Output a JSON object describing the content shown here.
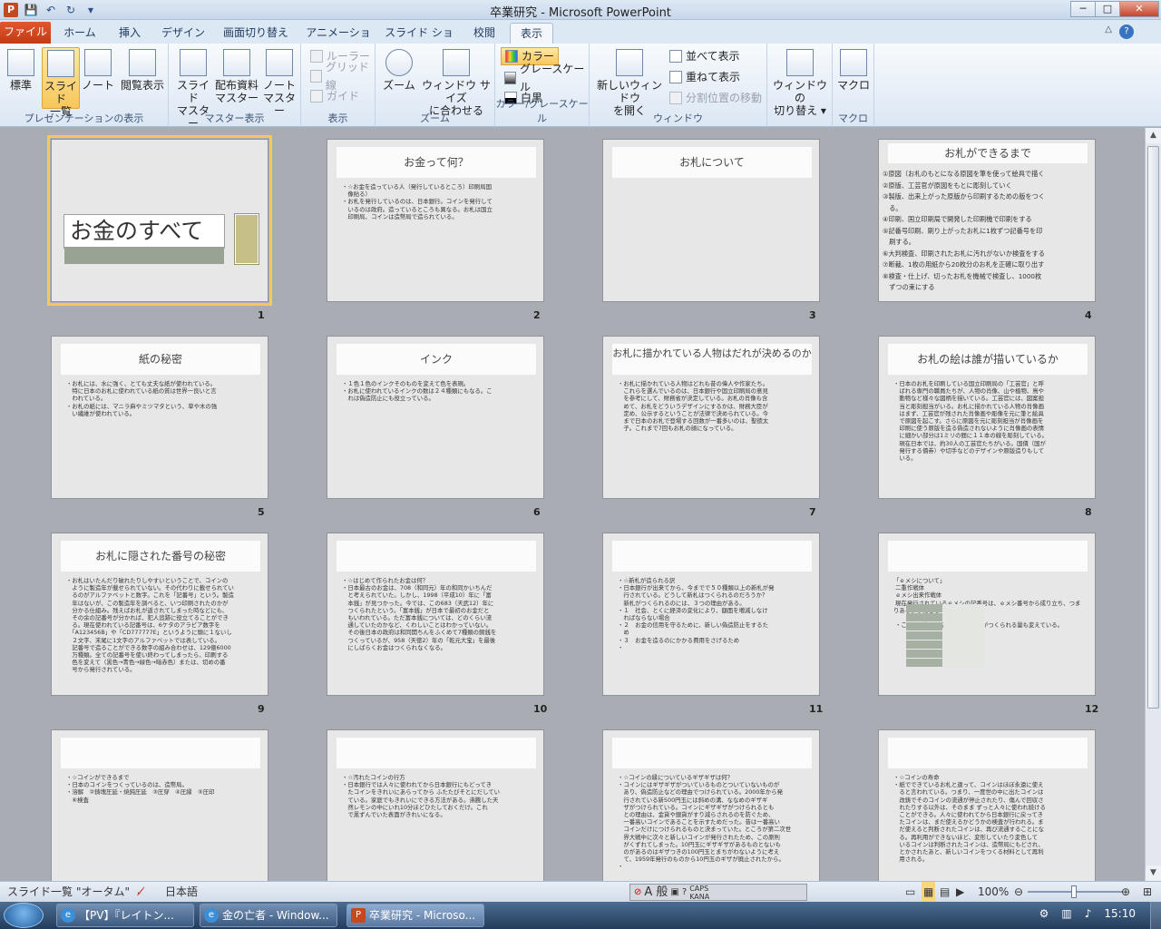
{
  "window": {
    "title": "卒業研究 - Microsoft PowerPoint",
    "app_icon": "P",
    "minimize": "─",
    "maximize": "□",
    "close": "✕"
  },
  "qat": {
    "save": "💾",
    "undo": "↶",
    "redo": "↻",
    "customize": "▾"
  },
  "tabs": [
    {
      "label": "ファイル"
    },
    {
      "label": "ホーム"
    },
    {
      "label": "挿入"
    },
    {
      "label": "デザイン"
    },
    {
      "label": "画面切り替え"
    },
    {
      "label": "アニメーション"
    },
    {
      "label": "スライド ショー"
    },
    {
      "label": "校閲"
    },
    {
      "label": "表示"
    }
  ],
  "ribbon": {
    "groups": {
      "presentation_views": "プレゼンテーションの表示",
      "master_views": "マスター表示",
      "show": "表示",
      "zoom": "ズーム",
      "color": "カラー/グレースケール",
      "window": "ウィンドウ",
      "macros": "マクロ"
    },
    "buttons": {
      "normal": "標準",
      "sorter_1": "スライド",
      "sorter_2": "一覧",
      "notes": "ノート",
      "reading": "閲覧表示",
      "slide_master_1": "スライド",
      "slide_master_2": "マスター",
      "handout_master_1": "配布資料",
      "handout_master_2": "マスター",
      "notes_master_1": "ノート",
      "notes_master_2": "マスター",
      "ruler": "ルーラー",
      "gridlines": "グリッド線",
      "guides": "ガイド",
      "zoom": "ズーム",
      "fit_1": "ウィンドウ サイズ",
      "fit_2": "に合わせる",
      "color": "カラー",
      "grayscale": "グレースケール",
      "bw": "白黒",
      "new_window_1": "新しいウィンドウ",
      "new_window_2": "を開く",
      "arrange_all": "並べて表示",
      "cascade": "重ねて表示",
      "move_split": "分割位置の移動",
      "switch_1": "ウィンドウの",
      "switch_2": "切り替え ▾",
      "macros": "マクロ"
    }
  },
  "slides": [
    {
      "num": "1",
      "title": "お金のすべて",
      "body": ""
    },
    {
      "num": "2",
      "title": "お金って何？",
      "body": "・☆お金を造っている人（発行しているところ）印刷局国\n　像貼る）\n・お札を発行しているのは、日本銀行。コインを発行して\n　いるのは政府。造っているところも異なる。お札は国立\n　印刷局、コインは造幣局で造られている。"
    },
    {
      "num": "3",
      "title": "お札について",
      "body": ""
    },
    {
      "num": "4",
      "title": "お札ができるまで",
      "body": "①原図（お札のもとになる原図を筆を使って絵具で描く\n②原版、工芸官が原図をもとに彫刻していく\n③製版、出来上がった原版から印刷するための版をつく\n　る。\n④印刷、国立印刷局で開発した印刷機で印刷をする\n⑤記番号印刷、刷り上がったお札に1枚ずつ記番号を印\n　刷する。\n⑥大判検査、印刷されたお札に汚れがないか検査をする\n⑦断裁、1枚の用紙から20枚分のお札を正確に取り出す\n⑧検査・仕上げ、切ったお札を機械で検査し、1000枚\n　ずつの束にする"
    },
    {
      "num": "5",
      "title": "紙の秘密",
      "body": "・お札には、水に強く、とても丈夫な紙が使われている。\n　特に日本のお札に使われている紙の質は世界一良いと言\n　われている。\n・お札の紙には、マニラ麻やミツマタという、草や木の強\n　い繊維が使われている。"
    },
    {
      "num": "6",
      "title": "インク",
      "body": "・１色１色のインクそのものを変えて色を表現。\n・お札に使われているインクの数は２４種類にもなる。こ\n　れは偽造防止にも役立っている。"
    },
    {
      "num": "7",
      "title": "お札に描かれている人物はだれが決めるのか",
      "body": "・お札に描かれている人物はどれも昔の偉人や作家たち。\n　これらを選んでいるのは、日本銀行や国立印刷局の意見\n　を参考にして、財務省が決定している。お札の肖像も含\n　めて、お札をどういうデザインにするかは、財務大臣が\n　定め、公示するということが法律で決められている。今\n　まで日本のお札で登場する回数が一番多いのは、聖徳太\n　子。これまで7回もお札の顔になっている。"
    },
    {
      "num": "8",
      "title": "お札の絵は誰が描いているか",
      "body": "・日本のお札を印刷している国立印刷局の「工芸官」と呼\n　ばれる専門の職員たちが、人物の肖像、山や植物、鳥や\n　動物など様々な図柄を描いている。工芸官には、図案担\n　当と彫刻担当がいる。お札に描かれている人物の肖像画\n　はまず、工芸官が残された肖像画や彫像を元に筆と絵具\n　で原図を起こす。さらに原図を元に彫刻担当が肖像画を\n　印刷に使う原版を造る偽造されないように肖像画の表情\n　に細かい部分は1ミリの間に１１本の線を彫刻している。\n　現在日本では、約30人の工芸官たちがいる。国債（国が\n　発行する債券）や切手などのデザインや原版造りもして\n　いる。"
    },
    {
      "num": "9",
      "title": "お札に隠された番号の秘密",
      "body": "・お札はいたんだり破れたりしやすいということで、コインの\n　ように製造年が載せられていない。その代わりに載せられてい\n　るのがアルファベットと数字。これを「記番号」という。製造\n　年はないが、この製造年を調べると、いつ印刷されたのかが\n　分かる仕組み。残えばお札が返されてしまった時などにも、\n　その余の記番号が分かれば、犯人追跡に役立てることができ\n　る。現在使われている記番号は、6ケタのアラビア数字を\n　「A123456B」や「CD777777E」というように頭に１ないし\n　２文字、末尾に1文字のアルファベットでは表している。\n　記番号で造ることができる数字の組み合わせは、129億6000\n　万種類。全ての記番号を使い終わってしまったら、印刷する\n　色を変えて（黒色→青色→緑色→暗赤色）または、切めの番\n　号から発行されている。"
    },
    {
      "num": "10",
      "title": "",
      "body": "・☆はじめて作られたお金は何？\n・日本最古のお金は、708（和同元）年の和同かいちんだ\n　と考えられていた。しかし、1998（平成10）年に「富\n　本銭」が見つかった。今では、この683（天武12）年に\n　つくられたという。「富本銭」が日本で最初のお金だと\n　もいわれている。ただ富本銭については、どのくらい流\n　通していたのかなど、くわしいことはわかっていない。\n　その後日本の政府は和同開ちんをふくめて7種類の銅銭を\n　つくっているが、958（天徳2）年の「乾元大宝」を最後\n　にしばらくお金はつくられなくなる。"
    },
    {
      "num": "11",
      "title": "",
      "body": "・☆新札が造られる訳\n・日本銀行が出来てから、今までで５０種類以上の新札が発\n　行されている。どうして新札はつくられるのだろうか？\n　新札がつくられるのには、３つの理由がある。\n・１　社会、とくに経済の変化により、額面を増減しなけ\n　ればならない場合\n・２　お金の信用を守るために、新しい偽造防止をするた\n　め\n・３　お金を造るのにかかる費用をさげるため\n・"
    },
    {
      "num": "12",
      "title": "",
      "body": "「ｅメシについて」\n 二重作戦体\n ｅメシ出来作戦体\n 現在発行されているｅメシの記番号は、ｅメシ番号から成り立ち、つまりあるようになる\n\n ・これらの部屋にあわせてｅメシがつくられる量も変えている。"
    },
    {
      "num": "13",
      "title": "",
      "body": "・☆コインができるまで\n・日本のコインをつくっているのは、造幣局。\n・溶解　②鋳塊圧延・焼鈍圧延　③圧穿　④圧縁　⑤圧印\n　⑥検査"
    },
    {
      "num": "14",
      "title": "",
      "body": "・☆汚れたコインの行方\n・日本銀行では人々に使われてから日本銀行にもどってき\n　たコインをきれいにあらってから ふたたびそとにだしてい\n　ている。家庭でもきれいにできる方法がある。沸騰した天\n　然レモンの中にいれ10分ほどひたしておくだけ。これ\n　で黒ずんでいた表面がきれいになる。"
    },
    {
      "num": "15",
      "title": "",
      "body": "・☆コインの縁についているギザギザは何？\n・コインにはギザギザがついているものとついていないものが\n　あり、偽造防止などの理由でつけられている。2000年から発\n　行されている新500円玉には斜めの溝、ななめのギザギ\n　ザがつけられている。コインにギザギザがつけられるとも\n　との理由は、金貨や銀貨がすり減らされるのを防ぐため、\n　一番高いコインであることを示すためだった。昔は一番高い\n　コインだけにつけられるものと決まっていた。ところが第二次世\n　界大戦中に次々と新しいコインが発行されたため、この原則\n　がくずれてしまった。10円玉にギザギザがあるものとないも\n　のがあるのはギザつきの100円玉とまちがわないように考え\n　て、1959年発行のものから10円玉のギザが廃止されたから。\n・"
    },
    {
      "num": "16",
      "title": "",
      "body": "・☆コインの寿命\n・紙でできているお札と違って、コインはほぼ永遠に使え\n　ると言われている。つまり、一度世の中に出たコインは\n　改鋳でそのコインの流通が停止されたり、傷んで回収さ\n　れたりする以外は、そのまま ずっと人々に使われ続ける\n　ことができる。人々に使われてから日本銀行に戻ってき\n　たコインは、まだ使えるかどうかの検査が行われる。ま\n　だ使えると判断されたコインは、再び流通することにな\n　る。再利用ができないほど、変形していたり変色して\n　いるコインは判断されたコインは、造幣局にもどされ、\n　とかされたあと、新しいコインをつくる材料として再利\n　用される。"
    }
  ],
  "status": {
    "view": "スライド一覧",
    "theme": "\"オータム\"",
    "lang": "日本語",
    "zoom": "100%",
    "ime_mode": "A 般",
    "ime_caps": "CAPS",
    "ime_kana": "KANA"
  },
  "taskbar": {
    "tasks": [
      {
        "label": "【PV】『レイトン...",
        "icon": "e"
      },
      {
        "label": "金の亡者 - Window...",
        "icon": "e"
      },
      {
        "label": "卒業研究 - Microso...",
        "icon": "P"
      }
    ],
    "clock": "15:10"
  }
}
